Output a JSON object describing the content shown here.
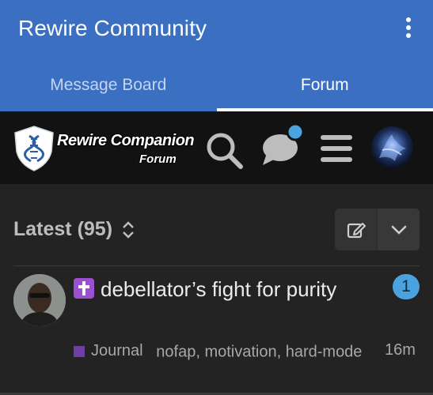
{
  "app": {
    "title": "Rewire Community"
  },
  "tabs": [
    {
      "label": "Message Board",
      "active": false
    },
    {
      "label": "Forum",
      "active": true
    }
  ],
  "forum_header": {
    "logo_text": "Rewire Companion",
    "logo_subtext": "Forum",
    "icons": [
      "search-icon",
      "chat-icon",
      "hamburger-menu-icon",
      "user-avatar"
    ],
    "chat_has_notification": true
  },
  "list": {
    "sort_label": "Latest (95)",
    "actions": [
      "new-topic-icon",
      "chevron-down-icon"
    ]
  },
  "topics": [
    {
      "title": "debellator’s fight for purity",
      "emoji": "latin-cross-emoji",
      "category": "Journal",
      "category_color": "#6f3fa3",
      "tags": "nofap, motivation, hard-mode",
      "unread_count": "1",
      "age": "16m"
    }
  ],
  "colors": {
    "app_bar": "#3B6FC2",
    "forum_header_bg": "#121212",
    "content_bg": "#232323",
    "badge": "#4aa3df"
  }
}
